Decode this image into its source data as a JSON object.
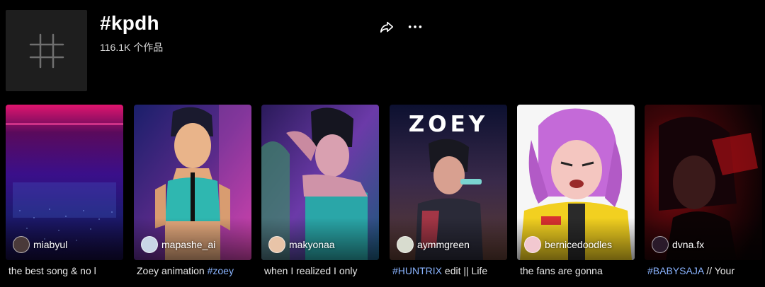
{
  "header": {
    "title": "#kpdh",
    "count": "116.1K 个作品",
    "icons": {
      "avatar": "hashtag-icon",
      "share": "share-icon",
      "more": "more-icon"
    }
  },
  "videos": [
    {
      "author": "miabyul",
      "caption_text": "the best song & no l",
      "caption_tag": "",
      "caption_rest": ""
    },
    {
      "author": "mapashe_ai",
      "caption_text": "Zoey animation ",
      "caption_tag": "#zoey",
      "caption_rest": ""
    },
    {
      "author": "makyonaa",
      "caption_text": "when I realized I only",
      "caption_tag": "",
      "caption_rest": ""
    },
    {
      "author": "aymmgreen",
      "caption_text": "",
      "caption_tag": "#HUNTRIX",
      "caption_rest": " edit || Life",
      "overlay": "ZOEY"
    },
    {
      "author": "bernicedoodles",
      "caption_text": "the fans are gonna",
      "caption_tag": "",
      "caption_rest": ""
    },
    {
      "author": "dvna.fx",
      "caption_text": "",
      "caption_tag": "#BABYSAJA",
      "caption_rest": " // Your"
    }
  ],
  "colors": {
    "background": "#000000",
    "hashtag": "#8ab4ff",
    "avatar_bg": "#1e1e1e"
  }
}
